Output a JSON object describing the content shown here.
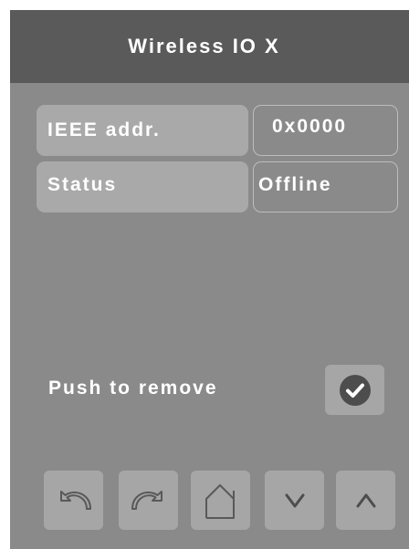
{
  "header": {
    "title": "Wireless IO X"
  },
  "fields": [
    {
      "label": "IEEE addr.",
      "value": "0x0000"
    },
    {
      "label": "Status",
      "value": "Offline"
    }
  ],
  "remove": {
    "label": "Push to remove",
    "icon": "check-circle-icon"
  },
  "nav": {
    "icons": [
      "undo-icon",
      "redo-icon",
      "home-icon",
      "chevron-down-icon",
      "chevron-up-icon"
    ]
  },
  "colors": {
    "background": "#8a8a8a",
    "title_bar": "#5a5a5a",
    "label_box": "#a9a9a9",
    "button": "#a6a6a6",
    "icon_dark": "#4d4d4d",
    "text": "#ffffff"
  }
}
